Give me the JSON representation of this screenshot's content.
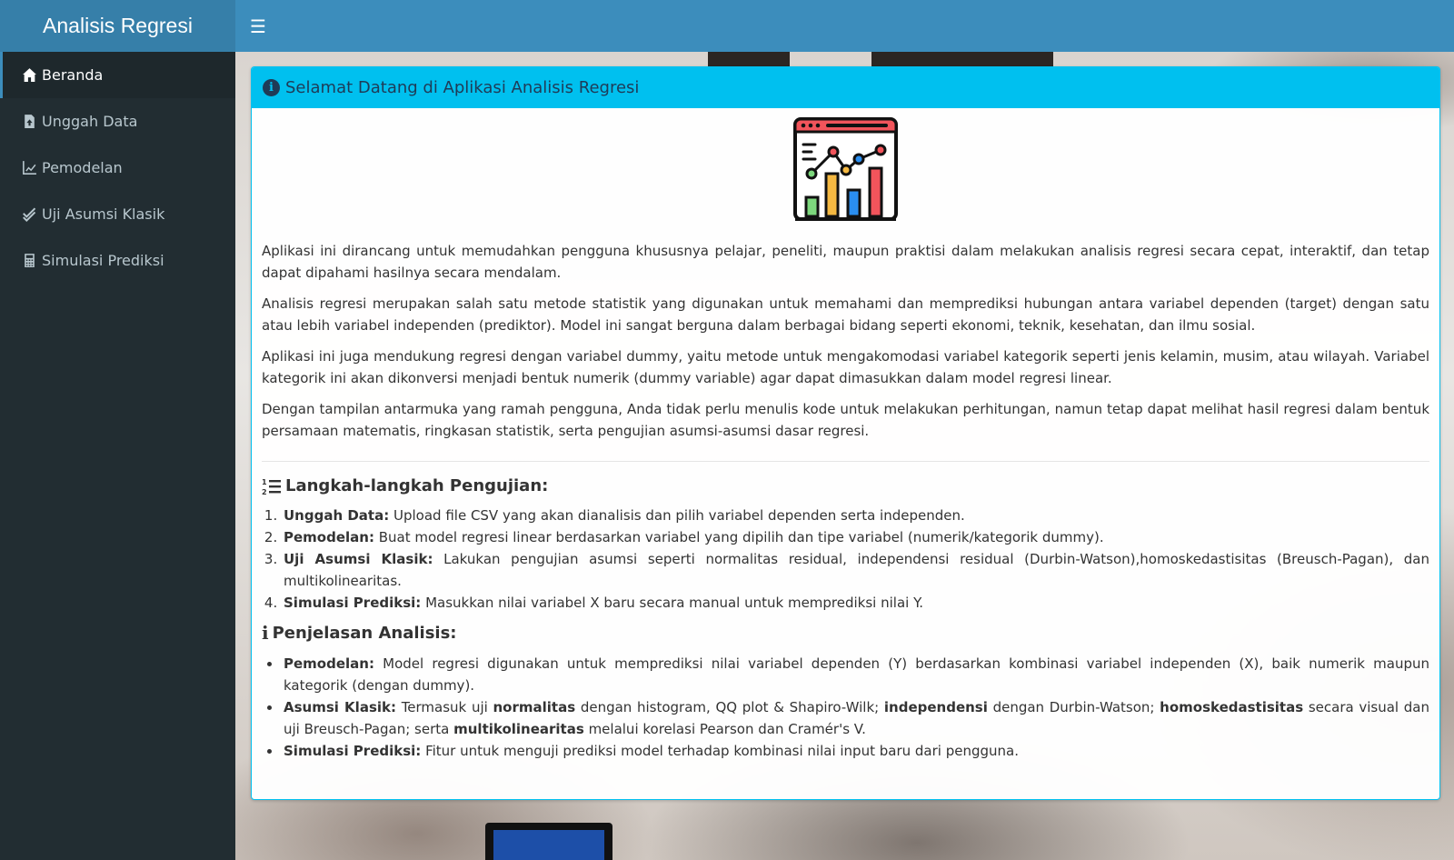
{
  "app": {
    "title": "Analisis Regresi"
  },
  "header": {
    "menu_icon": "hamburger-icon"
  },
  "sidebar": {
    "items": [
      {
        "label": "Beranda",
        "icon": "home-icon",
        "active": true
      },
      {
        "label": "Unggah Data",
        "icon": "file-upload-icon",
        "active": false
      },
      {
        "label": "Pemodelan",
        "icon": "line-chart-icon",
        "active": false
      },
      {
        "label": "Uji Asumsi Klasik",
        "icon": "double-check-icon",
        "active": false
      },
      {
        "label": "Simulasi Prediksi",
        "icon": "calculator-icon",
        "active": false
      }
    ]
  },
  "card": {
    "title": "Selamat Datang di Aplikasi Analisis Regresi",
    "paragraphs": [
      "Aplikasi ini dirancang untuk memudahkan pengguna khususnya pelajar, peneliti, maupun praktisi dalam melakukan analisis regresi secara cepat, interaktif, dan tetap dapat dipahami hasilnya secara mendalam.",
      "Analisis regresi merupakan salah satu metode statistik yang digunakan untuk memahami dan memprediksi hubungan antara variabel dependen (target) dengan satu atau lebih variabel independen (prediktor). Model ini sangat berguna dalam berbagai bidang seperti ekonomi, teknik, kesehatan, dan ilmu sosial.",
      "Aplikasi ini juga mendukung regresi dengan variabel dummy, yaitu metode untuk mengakomodasi variabel kategorik seperti jenis kelamin, musim, atau wilayah. Variabel kategorik ini akan dikonversi menjadi bentuk numerik (dummy variable) agar dapat dimasukkan dalam model regresi linear.",
      "Dengan tampilan antarmuka yang ramah pengguna, Anda tidak perlu menulis kode untuk melakukan perhitungan, namun tetap dapat melihat hasil regresi dalam bentuk persamaan matematis, ringkasan statistik, serta pengujian asumsi-asumsi dasar regresi."
    ],
    "steps_title": "Langkah-langkah Pengujian:",
    "steps": [
      {
        "label": "Unggah Data:",
        "text": " Upload file CSV yang akan dianalisis dan pilih variabel dependen serta independen."
      },
      {
        "label": "Pemodelan:",
        "text": " Buat model regresi linear berdasarkan variabel yang dipilih dan tipe variabel (numerik/kategorik dummy)."
      },
      {
        "label": "Uji Asumsi Klasik:",
        "text": " Lakukan pengujian asumsi seperti normalitas residual, independensi residual (Durbin-Watson),homoskedastisitas (Breusch-Pagan), dan multikolinearitas."
      },
      {
        "label": "Simulasi Prediksi:",
        "text": " Masukkan nilai variabel X baru secara manual untuk memprediksi nilai Y."
      }
    ],
    "explain_title": "Penjelasan Analisis:",
    "explain": {
      "pemodelan_label": "Pemodelan:",
      "pemodelan_text": " Model regresi digunakan untuk memprediksi nilai variabel dependen (Y) berdasarkan kombinasi variabel independen (X), baik numerik maupun kategorik (dengan dummy).",
      "asumsi_label": "Asumsi Klasik:",
      "asumsi_t1": " Termasuk uji ",
      "asumsi_b1": "normalitas",
      "asumsi_t2": " dengan histogram, QQ plot & Shapiro-Wilk; ",
      "asumsi_b2": "independensi",
      "asumsi_t3": " dengan Durbin-Watson; ",
      "asumsi_b3": "homoskedastisitas",
      "asumsi_t4": " secara visual dan uji Breusch-Pagan; serta ",
      "asumsi_b4": "multikolinearitas",
      "asumsi_t5": " melalui korelasi Pearson dan Cramér's V.",
      "simulasi_label": "Simulasi Prediksi:",
      "simulasi_text": " Fitur untuk menguji prediksi model terhadap kombinasi nilai input baru dari pengguna."
    }
  },
  "colors": {
    "header": "#3c8dbc",
    "logo": "#367fa9",
    "sidebar": "#222d32",
    "card_header": "#00c0ef",
    "title_text": "#1f3b57"
  }
}
